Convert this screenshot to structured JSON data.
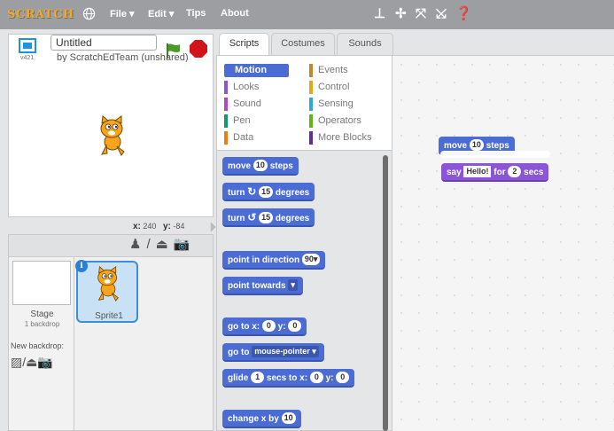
{
  "menu": {
    "logo": "SCRATCH",
    "file": "File ▾",
    "edit": "Edit ▾",
    "tips": "Tips",
    "about": "About",
    "tool_icons": [
      "duplicate-icon",
      "cut-icon",
      "grow-icon",
      "shrink-icon",
      "help-icon"
    ]
  },
  "project": {
    "title": "Untitled",
    "byline": "by ScratchEdTeam (unshared)",
    "version": "v421"
  },
  "stage": {
    "x_label": "x:",
    "x_value": "240",
    "y_label": "y:",
    "y_value": "-84"
  },
  "sprites": {
    "stage_label": "Stage",
    "stage_sub": "1 backdrop",
    "new_backdrop": "New backdrop:",
    "sprite1": "Sprite1",
    "info": "i"
  },
  "tabs": {
    "scripts": "Scripts",
    "costumes": "Costumes",
    "sounds": "Sounds"
  },
  "categories": {
    "motion": "Motion",
    "looks": "Looks",
    "sound": "Sound",
    "pen": "Pen",
    "data": "Data",
    "events": "Events",
    "control": "Control",
    "sensing": "Sensing",
    "operators": "Operators",
    "more_blocks": "More Blocks"
  },
  "category_colors": {
    "motion": "#4a6cd4",
    "looks": "#8a55d7",
    "sound": "#bb42c3",
    "pen": "#0e9a6c",
    "data": "#ee7d16",
    "events": "#c88330",
    "control": "#e1a91a",
    "sensing": "#2ca5e2",
    "operators": "#5cb712",
    "more_blocks": "#632d99"
  },
  "blocks": {
    "move": "move",
    "move_val": "10",
    "steps": "steps",
    "turn": "turn",
    "turn_val1": "15",
    "turn_val2": "15",
    "degrees": "degrees",
    "point_in_direction": "point in direction",
    "direction_val": "90▾",
    "point_towards": "point towards",
    "towards_drop": "▾",
    "go_to_x": "go to x:",
    "goto_x": "0",
    "y": "y:",
    "goto_y": "0",
    "go_to": "go to",
    "mouse_pointer": "mouse-pointer ▾",
    "glide": "glide",
    "glide_secs": "1",
    "secs_to_x": "secs to x:",
    "glide_x": "0",
    "glide_y": "0",
    "change_x_by": "change x by",
    "change_x_val": "10"
  },
  "script": {
    "move": "move",
    "move_val": "10",
    "steps": "steps",
    "say": "say",
    "say_text": "Hello!",
    "for": "for",
    "say_secs": "2",
    "secs": "secs"
  }
}
